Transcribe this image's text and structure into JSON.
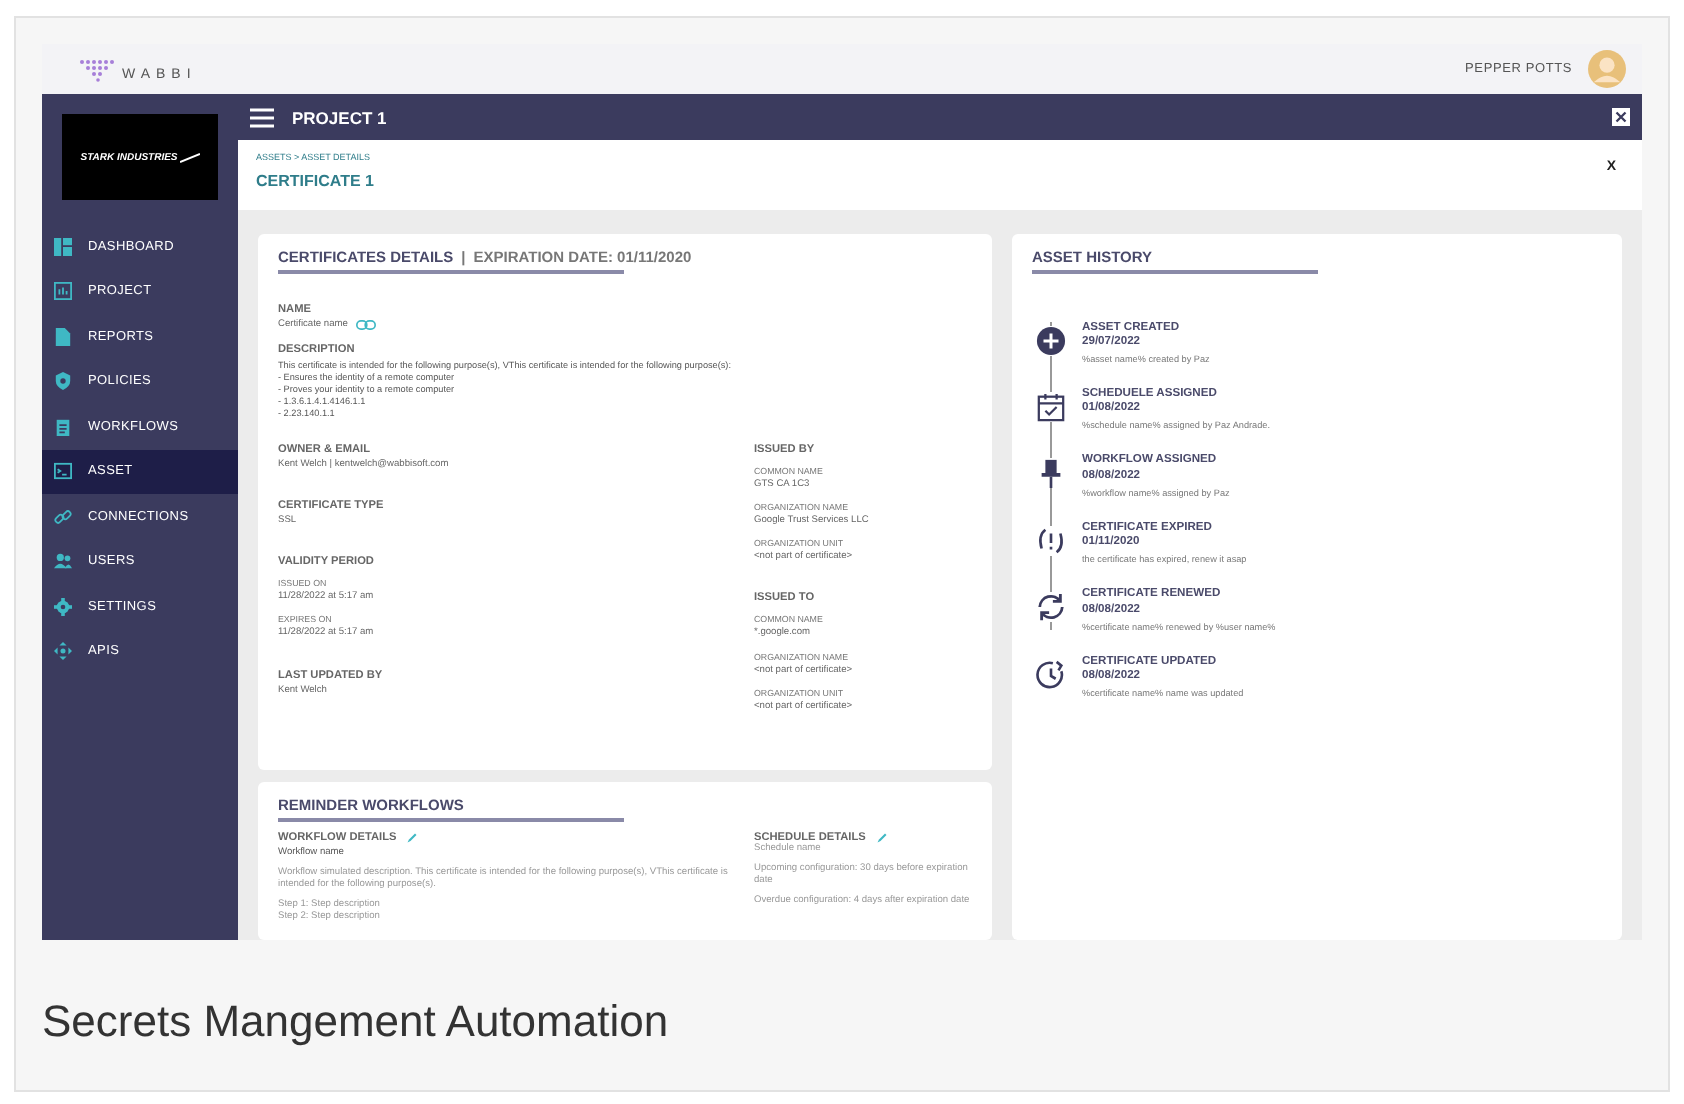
{
  "app": {
    "logo": "WABBI",
    "user": "PEPPER POTTS"
  },
  "company_logo": {
    "text": "STARK INDUSTRIES"
  },
  "sidebar": {
    "items": [
      {
        "label": "DASHBOARD",
        "selected": false
      },
      {
        "label": "PROJECT",
        "selected": false
      },
      {
        "label": "REPORTS",
        "selected": false
      },
      {
        "label": "POLICIES",
        "selected": false
      },
      {
        "label": "WORKFLOWS",
        "selected": false
      },
      {
        "label": "ASSET",
        "selected": true
      },
      {
        "label": "CONNECTIONS",
        "selected": false
      },
      {
        "label": "USERS",
        "selected": false
      },
      {
        "label": "SETTINGS",
        "selected": false
      },
      {
        "label": "APIS",
        "selected": false
      }
    ]
  },
  "header": {
    "title": "PROJECT 1"
  },
  "breadcrumb": "ASSETS > ASSET DETAILS",
  "page_title": "CERTIFICATE 1",
  "close_label": "X",
  "details": {
    "title": "CERTIFICATES DETAILS",
    "separator": "|",
    "expiration": "EXPIRATION DATE: 01/11/2020",
    "name_label": "NAME",
    "name": "Certificate name",
    "description_label": "DESCRIPTION",
    "description": [
      "This certificate is intended for the following purpose(s), VThis certificate is intended for the following purpose(s):",
      "- Ensures the identity of a remote computer",
      "- Proves your identity to a remote computer",
      "- 1.3.6.1.4.1.4146.1.1",
      "- 2.23.140.1.1"
    ],
    "left_sections": [
      {
        "label": "OWNER & EMAIL",
        "value": "Kent Welch | kentwelch@wabbisoft.com"
      },
      {
        "label": "CERTIFICATE TYPE",
        "value": "SSL"
      },
      {
        "label": "VALIDITY PERIOD",
        "fields": [
          {
            "label": "ISSUED ON",
            "value": "11/28/2022 at 5:17 am"
          },
          {
            "label": "EXPIRES ON",
            "value": "11/28/2022 at 5:17 am"
          }
        ]
      },
      {
        "label": "LAST UPDATED BY",
        "value": "Kent Welch"
      }
    ],
    "right_sections": [
      {
        "label": "ISSUED BY",
        "fields": [
          {
            "label": "COMMON NAME",
            "value": "GTS CA 1C3"
          },
          {
            "label": "ORGANIZATION NAME",
            "value": "Google Trust Services LLC"
          },
          {
            "label": "ORGANIZATION UNIT",
            "value": "<not part of certificate>"
          }
        ]
      },
      {
        "label": "ISSUED TO",
        "fields": [
          {
            "label": "COMMON NAME",
            "value": "*.google.com"
          },
          {
            "label": "ORGANIZATION NAME",
            "value": "<not part of certificate>"
          },
          {
            "label": "ORGANIZATION UNIT",
            "value": "<not part of certificate>"
          }
        ]
      }
    ]
  },
  "reminder": {
    "title": "REMINDER WORKFLOWS",
    "workflow": {
      "label": "WORKFLOW DETAILS",
      "name": "Workflow name",
      "description": "Workflow simulated description. This certificate is intended for the following purpose(s), VThis certificate is intended for the following purpose(s).",
      "steps": [
        "Step 1: Step description",
        "Step 2: Step description"
      ]
    },
    "schedule": {
      "label": "SCHEDULE DETAILS",
      "name": "Schedule name",
      "lines": [
        "Upcoming configuration:  30 days before expiration date",
        "Overdue configuration: 4 days after expiration date"
      ]
    }
  },
  "history": {
    "title": "ASSET HISTORY",
    "events": [
      {
        "kind": "created",
        "title": "ASSET  CREATED",
        "date": "29/07/2022",
        "text": "%asset name%  created by Paz"
      },
      {
        "kind": "schedule",
        "title": "SCHEDUELE ASSIGNED",
        "date": "01/08/2022",
        "text": "%schedule name% assigned  by Paz Andrade."
      },
      {
        "kind": "workflow",
        "title": "WORKFLOW ASSIGNED",
        "date": "08/08/2022",
        "text": "%workflow name% assigned by Paz"
      },
      {
        "kind": "expired",
        "title": "CERTIFICATE EXPIRED",
        "date": "01/11/2020",
        "text": "the certificate has expired, renew it asap"
      },
      {
        "kind": "renewed",
        "title": "CERTIFICATE RENEWED",
        "date": "08/08/2022",
        "text": "%certificate name% renewed by %user name%"
      },
      {
        "kind": "updated",
        "title": "CERTIFICATE UPDATED",
        "date": "08/08/2022",
        "text": "%certificate name% name was updated"
      }
    ]
  },
  "caption": "Secrets Mangement Automation"
}
